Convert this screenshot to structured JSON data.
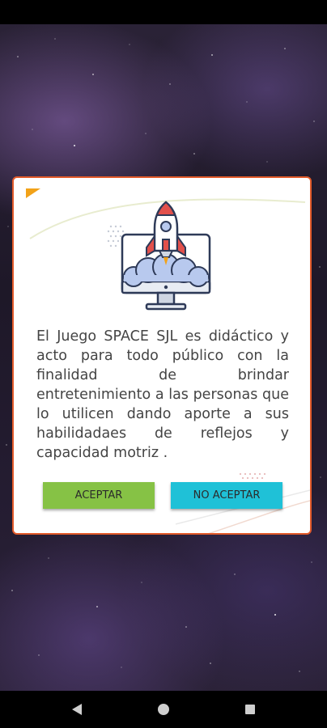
{
  "dialog": {
    "message": "El Juego SPACE SJL es didáctico y acto para todo público con la finalidad de brindar entretenimiento a las personas que lo utilicen dando aporte a sus habilidadaes de reflejos y capacidad motriz .",
    "accept_label": "ACEPTAR",
    "decline_label": "NO ACEPTAR",
    "illustration_icon": "rocket-launch-monitor-icon"
  },
  "colors": {
    "dialog_border": "#e25a2a",
    "accept_button": "#86c245",
    "decline_button": "#1fc1d7",
    "message_text": "#444444"
  },
  "navigation": {
    "back_icon": "triangle-back-icon",
    "home_icon": "circle-home-icon",
    "recents_icon": "square-recents-icon"
  }
}
